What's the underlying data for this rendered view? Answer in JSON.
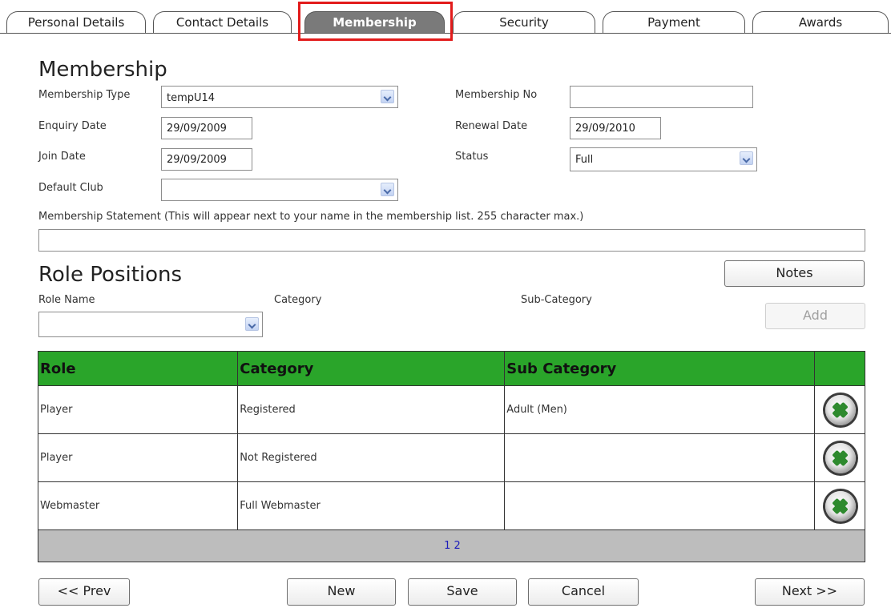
{
  "tabs": [
    {
      "label": "Personal Details"
    },
    {
      "label": "Contact Details"
    },
    {
      "label": "Membership"
    },
    {
      "label": "Security"
    },
    {
      "label": "Payment"
    },
    {
      "label": "Awards"
    }
  ],
  "membership": {
    "heading": "Membership",
    "type_label": "Membership Type",
    "type_value": "tempU14",
    "enquiry_label": "Enquiry Date",
    "enquiry_value": "29/09/2009",
    "join_label": "Join Date",
    "join_value": "29/09/2009",
    "club_label": "Default Club",
    "club_value": "",
    "number_label": "Membership No",
    "number_value": "",
    "renewal_label": "Renewal Date",
    "renewal_value": "29/09/2010",
    "status_label": "Status",
    "status_value": "Full",
    "statement_label": "Membership Statement (This will appear next to your name in the membership list. 255 character max.)",
    "statement_value": ""
  },
  "roles": {
    "heading": "Role Positions",
    "notes_button": "Notes",
    "role_name_label": "Role Name",
    "category_label": "Category",
    "subcategory_label": "Sub-Category",
    "add_button": "Add",
    "columns": [
      "Role",
      "Category",
      "Sub Category"
    ],
    "rows": [
      {
        "role": "Player",
        "category": "Registered",
        "sub": "Adult (Men)"
      },
      {
        "role": "Player",
        "category": "Not Registered",
        "sub": ""
      },
      {
        "role": "Webmaster",
        "category": "Full Webmaster",
        "sub": ""
      }
    ],
    "pager": "1 2"
  },
  "footer": {
    "prev": "<< Prev",
    "new": "New",
    "save": "Save",
    "cancel": "Cancel",
    "next": "Next >>"
  },
  "colors": {
    "accent_green": "#2aa52a",
    "active_tab": "#7a7a7a",
    "highlight": "#e21b1b"
  }
}
